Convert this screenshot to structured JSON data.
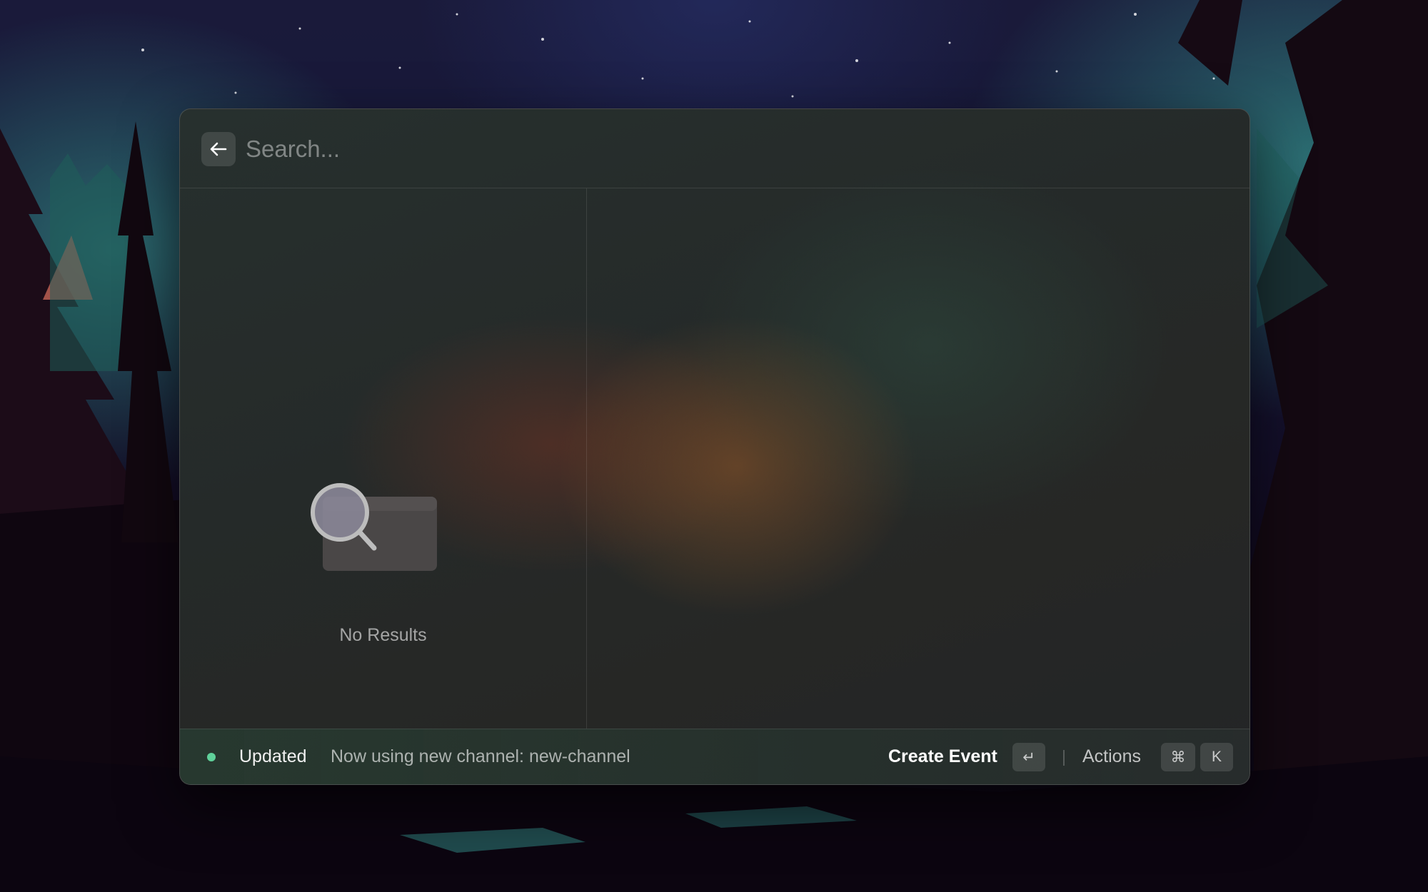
{
  "search": {
    "placeholder": "Search...",
    "value": ""
  },
  "empty_state": {
    "icon": "magnifier-folder-icon",
    "text": "No Results"
  },
  "footer": {
    "status_title": "Updated",
    "status_message": "Now using new channel: new-channel",
    "status_color": "#5fd19a",
    "primary_action": "Create Event",
    "primary_shortcut": "↵",
    "actions_label": "Actions",
    "actions_shortcut_mod": "⌘",
    "actions_shortcut_key": "K"
  }
}
